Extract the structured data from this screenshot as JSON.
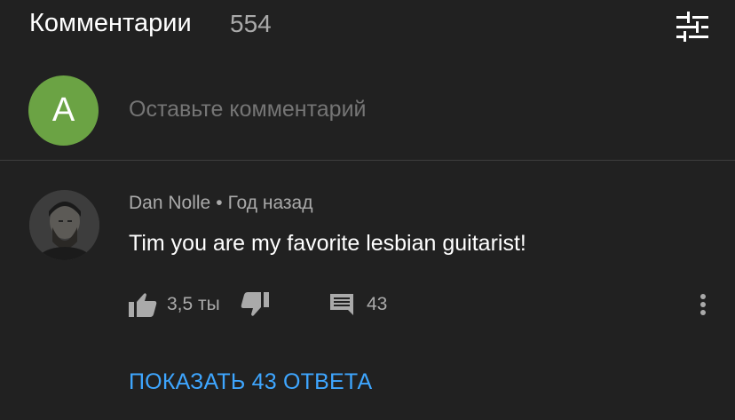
{
  "header": {
    "title": "Комментарии",
    "count": "554",
    "sort_icon": "sort-sliders-icon"
  },
  "add_comment": {
    "avatar_letter": "A",
    "avatar_color": "#6ba344",
    "placeholder": "Оставьте комментарий"
  },
  "comment": {
    "author": "Dan Nolle",
    "separator": "•",
    "time": "Год назад",
    "text": "Tim you are my favorite lesbian guitarist!",
    "likes": "3,5 ты",
    "replies_count": "43",
    "show_replies": "ПОКАЗАТЬ 43 ОТВЕТА"
  },
  "colors": {
    "background": "#212121",
    "accent": "#3ea6ff",
    "muted": "#aaaaaa"
  }
}
